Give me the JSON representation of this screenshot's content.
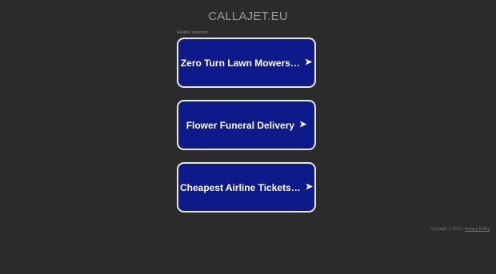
{
  "header": {
    "domain": "CALLAJET.EU"
  },
  "related": {
    "label": "Related searches",
    "items": [
      {
        "label": "Zero Turn Lawn Mowers…",
        "arrow": "➤"
      },
      {
        "label": "Flower Funeral Delivery",
        "arrow": "➤"
      },
      {
        "label": "Cheapest Airline Tickets…",
        "arrow": "➤"
      }
    ]
  },
  "footer": {
    "copyright": "Copyright © 2021 |",
    "privacy_link": "Privacy Policy"
  },
  "colors": {
    "background": "#2b2b2b",
    "box_fill": "#0e1a8a",
    "box_border": "#e8e8e8",
    "title_text": "#9a9a9a"
  }
}
